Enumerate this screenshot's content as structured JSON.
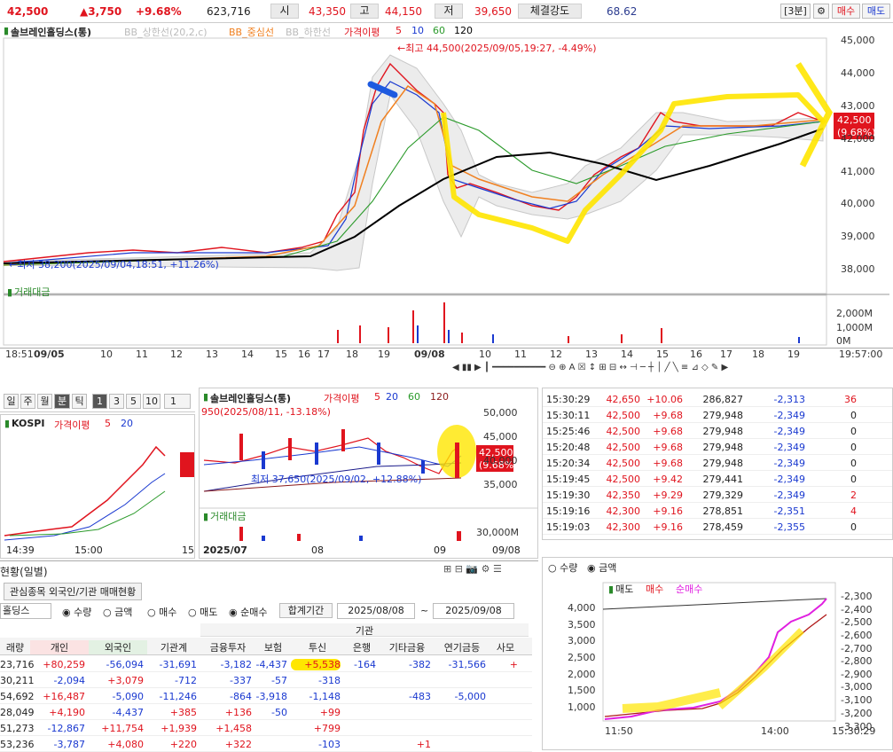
{
  "ticker": {
    "price": "42,500",
    "change": "▲3,750",
    "change_pct": "+9.68%",
    "volume": "623,716",
    "open_label": "시",
    "open": "43,350",
    "high_label": "고",
    "high": "44,150",
    "low_label": "저",
    "low": "39,650",
    "strength_label": "체결강도",
    "strength": "68.62",
    "interval": "[3분]",
    "buy_label": "매수",
    "sell_label": "매도"
  },
  "main_chart": {
    "legend": {
      "name": "솔브레인홀딩스(통)",
      "bb_upper": "BB_상한선(20,2,c)",
      "bb_mid": "BB_중심선",
      "bb_lower": "BB_하한선",
      "ma_label": "가격이평",
      "ma5": "5",
      "ma10": "10",
      "ma60": "60",
      "ma120": "120"
    },
    "high_note": "←최고 44,500(2025/09/05,19:27, -4.49%)",
    "low_note": "←최저 38,200(2025/09/04,18:51, +11.26%)",
    "price_tag": "42,500",
    "price_tag_pct": "(9.68%)",
    "y_ticks": [
      "45,000",
      "44,000",
      "43,000",
      "42,000",
      "41,000",
      "40,000",
      "39,000",
      "38,000"
    ],
    "vol_label": "거래대금",
    "vol_ticks": [
      "2,000M",
      "1,000M",
      "0M"
    ],
    "x_ticks": [
      "18:51",
      "09/05",
      "10",
      "11",
      "12",
      "13",
      "14",
      "15",
      "16",
      "17",
      "18",
      "19",
      "09/08",
      "10",
      "11",
      "12",
      "13",
      "14",
      "15",
      "16",
      "17",
      "18",
      "19",
      "19:57:00"
    ]
  },
  "period": {
    "tabs": [
      "일",
      "주",
      "월",
      "분",
      "틱"
    ],
    "nums": [
      "1",
      "3",
      "5",
      "10"
    ],
    "sel": "1"
  },
  "kospi": {
    "title": "KOSPI",
    "ma_label": "가격이평",
    "ma5": "5",
    "ma20": "20",
    "x_ticks": [
      "14:39",
      "15:00",
      "15"
    ]
  },
  "daily_chart": {
    "name": "솔브레인홀딩스(통)",
    "ma_label": "가격이평",
    "ma5": "5",
    "ma20": "20",
    "ma60": "60",
    "ma120": "120",
    "high_note": "950(2025/08/11, -13.18%)",
    "low_note": "최저 37,650(2025/09/02, +12.88%)",
    "y_ticks": [
      "50,000",
      "45,000",
      "40,000",
      "35,000"
    ],
    "tag": "42,500",
    "tag_pct": "(9.68%)",
    "vol_label": "거래대금",
    "vol_tick": "30,000M",
    "x_ticks": [
      "2025/07",
      "08",
      "09",
      "09/08"
    ]
  },
  "trades": {
    "rows": [
      [
        "15:30:29",
        "42,650",
        "+10.06",
        "286,827",
        "-2,313",
        "36"
      ],
      [
        "15:30:11",
        "42,500",
        "+9.68",
        "279,948",
        "-2,349",
        "0"
      ],
      [
        "15:25:46",
        "42,500",
        "+9.68",
        "279,948",
        "-2,349",
        "0"
      ],
      [
        "15:20:48",
        "42,500",
        "+9.68",
        "279,948",
        "-2,349",
        "0"
      ],
      [
        "15:20:34",
        "42,500",
        "+9.68",
        "279,948",
        "-2,349",
        "0"
      ],
      [
        "15:19:45",
        "42,500",
        "+9.42",
        "279,441",
        "-2,349",
        "0"
      ],
      [
        "15:19:30",
        "42,350",
        "+9.29",
        "279,329",
        "-2,349",
        "2"
      ],
      [
        "15:19:16",
        "42,300",
        "+9.16",
        "278,851",
        "-2,351",
        "4"
      ],
      [
        "15:19:03",
        "42,300",
        "+9.16",
        "278,459",
        "-2,355",
        "0"
      ]
    ]
  },
  "investor": {
    "title": "현황(일별)",
    "tab": "관심종목 외국인/기관 매매현황",
    "stock": "홀딩스",
    "radio1": [
      "수량",
      "금액"
    ],
    "radio2": [
      "매수",
      "매도",
      "순매수"
    ],
    "period_label": "합계기간",
    "from": "2025/08/08",
    "to": "2025/09/08",
    "inst_label": "기관",
    "headers": [
      "래량",
      "개인",
      "외국인",
      "기관계",
      "금융투자",
      "보험",
      "투신",
      "은행",
      "기타금융",
      "연기금등",
      "사모"
    ],
    "rows": [
      [
        "23,716",
        "+80,259",
        "-56,094",
        "-31,691",
        "-3,182",
        "-4,437",
        "+5,538",
        "-164",
        "-382",
        "-31,566",
        "+"
      ],
      [
        "30,211",
        "-2,094",
        "+3,079",
        "-712",
        "-337",
        "-57",
        "-318",
        "",
        "",
        "",
        ""
      ],
      [
        "54,692",
        "+16,487",
        "-5,090",
        "-11,246",
        "-864",
        "-3,918",
        "-1,148",
        "",
        "-483",
        "-5,000",
        ""
      ],
      [
        "28,049",
        "+4,190",
        "-4,437",
        "+385",
        "+136",
        "-50",
        "+99",
        "",
        "",
        "",
        ""
      ],
      [
        "51,273",
        "-12,867",
        "+11,754",
        "+1,939",
        "+1,458",
        "",
        "+799",
        "",
        "",
        "",
        ""
      ],
      [
        "53,236",
        "-3,787",
        "+4,080",
        "+220",
        "+322",
        "",
        "-103",
        "",
        "+1",
        "",
        ""
      ]
    ]
  },
  "intraday": {
    "radio": [
      "수량",
      "금액"
    ],
    "legend": [
      "매도",
      "매수",
      "순매수"
    ],
    "left_ticks": [
      "4,000",
      "3,500",
      "3,000",
      "2,500",
      "2,000",
      "1,500",
      "1,000"
    ],
    "right_ticks": [
      "-2,300",
      "-2,400",
      "-2,500",
      "-2,600",
      "-2,700",
      "-2,800",
      "-2,900",
      "-3,000",
      "-3,100",
      "-3,200",
      "-3,300"
    ],
    "x_ticks": [
      "11:50",
      "14:00",
      "15:30:29"
    ]
  }
}
